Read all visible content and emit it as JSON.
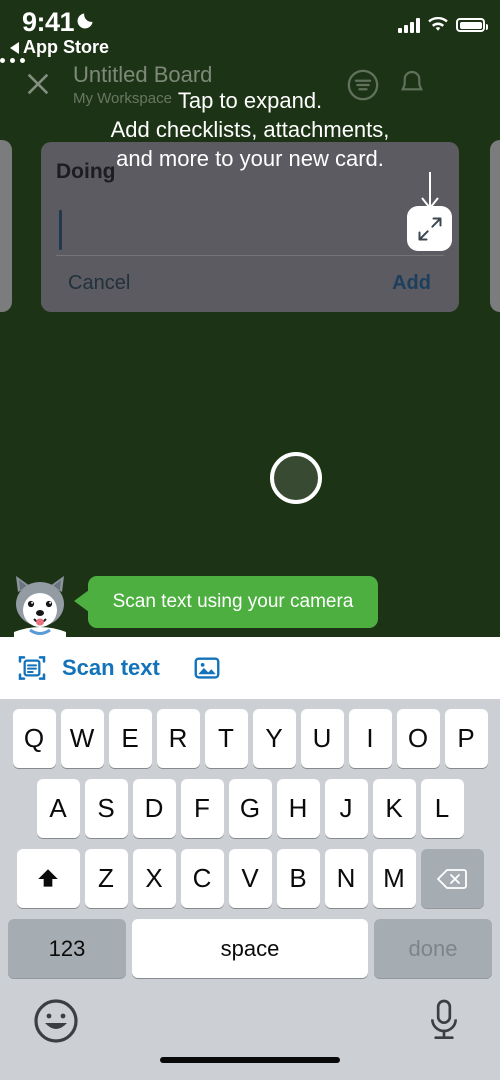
{
  "status_bar": {
    "time": "9:41",
    "moon_icon": "crescent-moon-icon",
    "back_label": "App Store",
    "signal_icon": "cellular-signal-icon",
    "wifi_icon": "wifi-icon",
    "battery_icon": "battery-full-icon"
  },
  "board_header": {
    "close_icon": "close-x-icon",
    "title": "Untitled Board",
    "subtitle": "My Workspace",
    "filter_icon": "filter-circle-icon",
    "bell_icon": "notifications-bell-icon",
    "overflow_icon": "overflow-menu-icon"
  },
  "composer": {
    "list_title": "Doing",
    "card_text_value": "",
    "cancel_label": "Cancel",
    "add_label": "Add",
    "expand_icon": "expand-diagonal-arrows-icon"
  },
  "coach_mark": {
    "line_1": "Tap to expand.",
    "line_2": "Add checklists, attachments,",
    "line_3": "and more to your new card.",
    "arrow_icon": "down-arrow-icon"
  },
  "camera": {
    "shutter_icon": "camera-shutter-icon"
  },
  "mascot": {
    "character": "husky-dog-mascot",
    "bubble_text": "Scan text using your camera"
  },
  "scan_bar": {
    "scan_icon": "scan-text-icon",
    "scan_label": "Scan text",
    "photo_icon": "photo-library-icon"
  },
  "keyboard": {
    "row_1": [
      "Q",
      "W",
      "E",
      "R",
      "T",
      "Y",
      "U",
      "I",
      "O",
      "P"
    ],
    "row_2": [
      "A",
      "S",
      "D",
      "F",
      "G",
      "H",
      "J",
      "K",
      "L"
    ],
    "row_3": [
      "Z",
      "X",
      "C",
      "V",
      "B",
      "N",
      "M"
    ],
    "shift_icon": "shift-up-arrow-icon",
    "backspace_icon": "backspace-delete-icon",
    "numbers_label": "123",
    "space_label": "space",
    "done_label": "done",
    "emoji_icon": "emoji-smiley-icon",
    "mic_icon": "microphone-icon"
  },
  "colors": {
    "board_background": "#1d3316",
    "bubble_green": "#4caf3f",
    "scan_blue": "#1272ba",
    "card_grey": "#5b5b61",
    "keyboard_grey": "#ccd0d4"
  }
}
